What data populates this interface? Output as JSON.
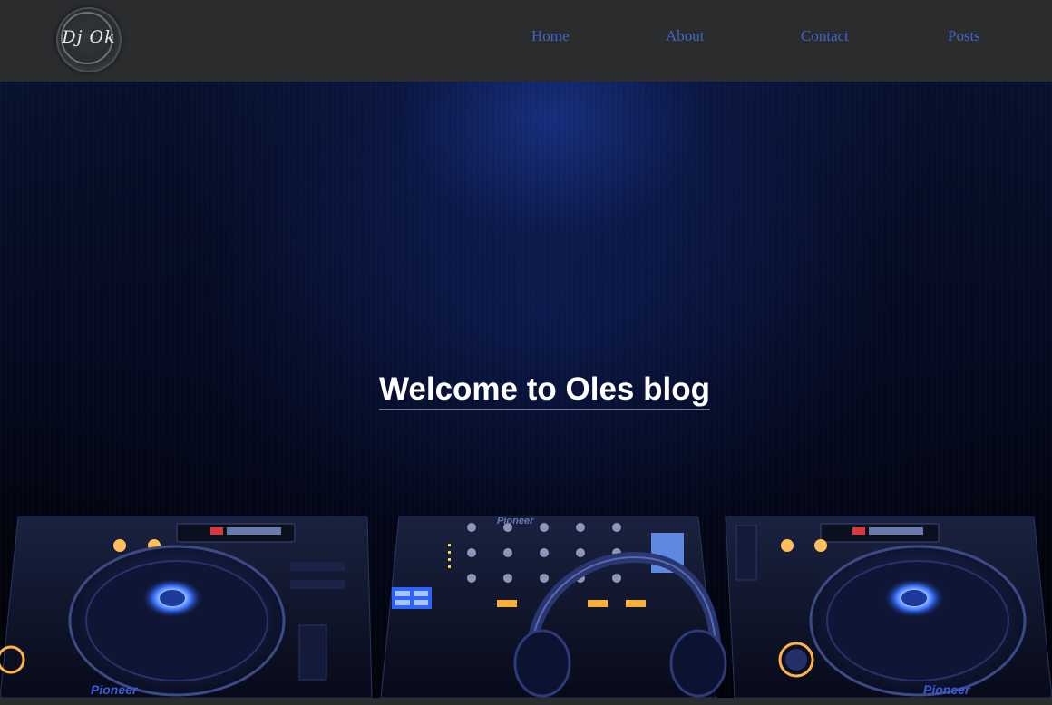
{
  "brand": {
    "logo_text": "Dj Ok"
  },
  "nav": {
    "home": "Home",
    "about": "About",
    "contact": "Contact",
    "posts": "Posts"
  },
  "hero": {
    "title": "Welcome to Oles blog",
    "deck_brand_left": "Pioneer",
    "deck_brand_right": "Pioneer",
    "mixer_brand": "Pioneer"
  },
  "colors": {
    "header_bg": "#2b2c2e",
    "nav_link": "#3f66c7",
    "hero_glow": "#1a348c",
    "title_text": "#ffffff"
  },
  "icons": {
    "logo": "dj-ok-logo-icon"
  }
}
